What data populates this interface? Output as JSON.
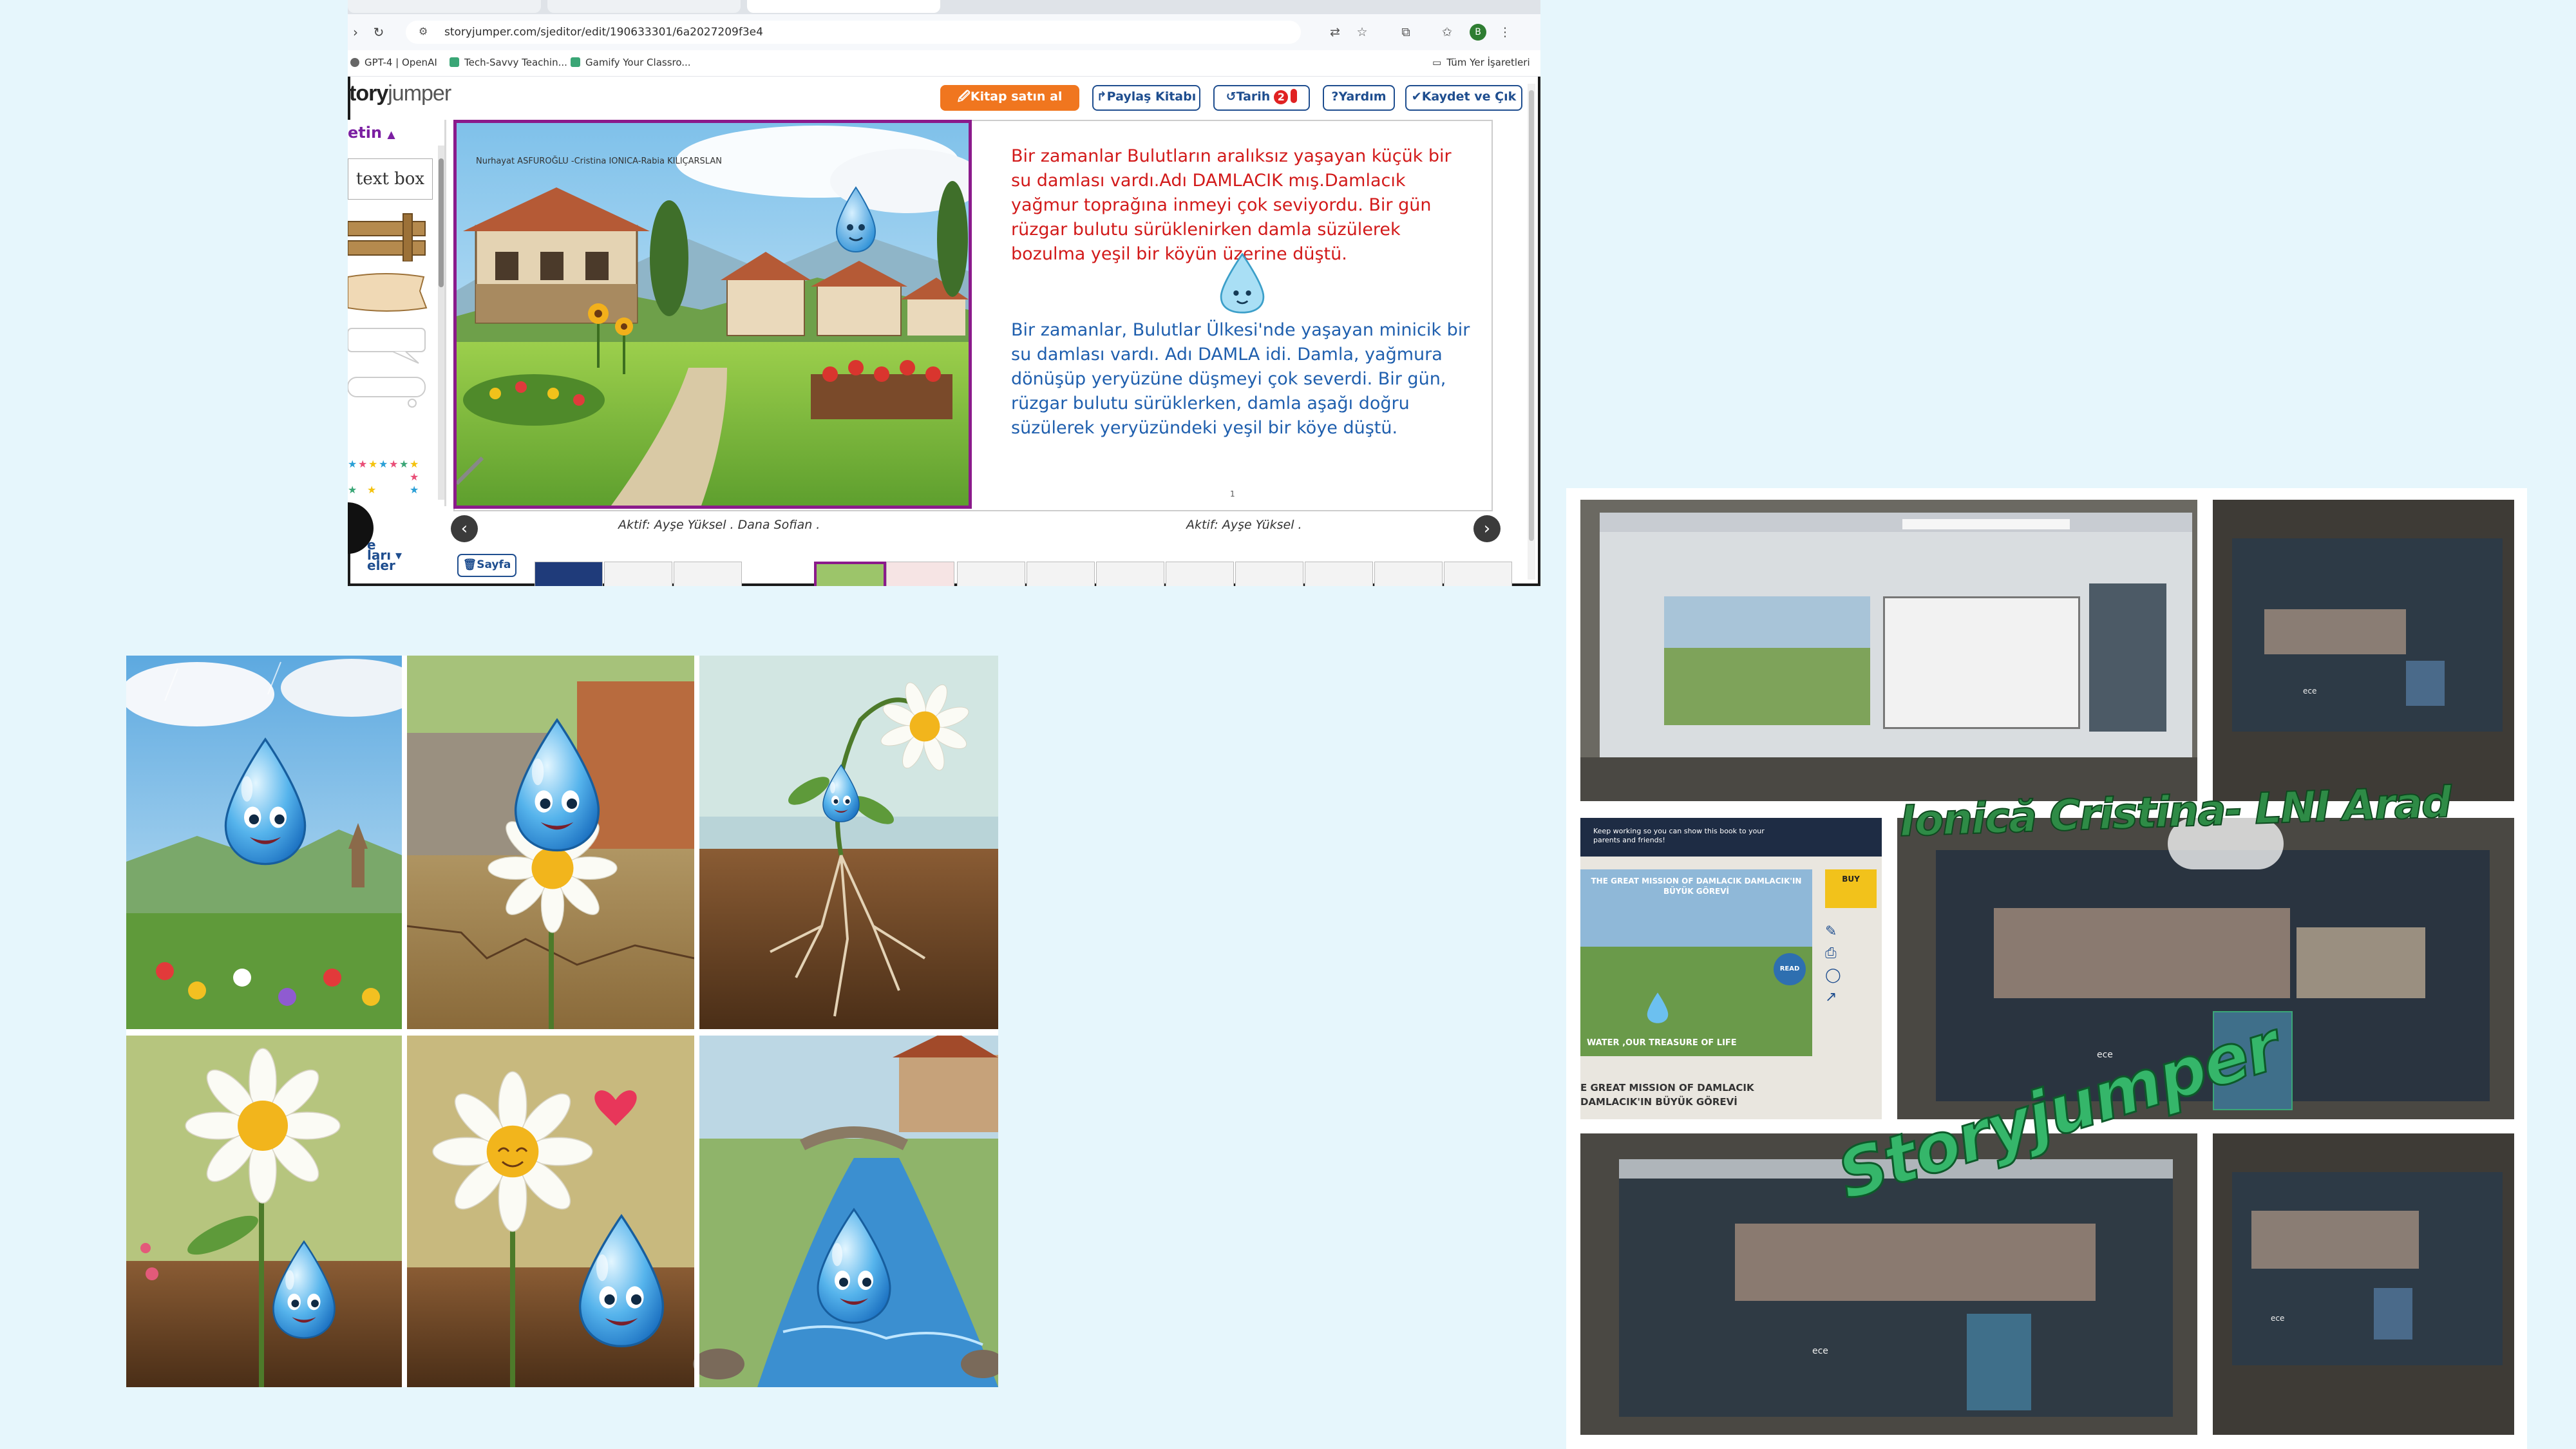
{
  "browser": {
    "url": "storyjumper.com/sjeditor/edit/190633301/6a2027209f3e4",
    "bookmarks": [
      "GPT-4 | OpenAI",
      "Tech-Savvy Teachin...",
      "Gamify Your Classro..."
    ],
    "bookmarks_folder": "Tüm Yer İşaretleri",
    "profile_letter": "B"
  },
  "editor": {
    "logo_start": "tory",
    "logo_end": "jumper",
    "toolbar": {
      "buy": "Kitap satın al",
      "share": "Paylaş Kitabı",
      "history": "Tarih",
      "history_badge": "2",
      "help": "Yardım",
      "save": "Kaydet ve Çık"
    },
    "left_panel": {
      "title": "etin",
      "textbox_label": "text box",
      "bottom_text_1": "e",
      "bottom_text_2": "ları",
      "bottom_text_3": "eler"
    },
    "page": {
      "credit": "Nurhayat ASFUROĞLU -Cristina IONICA-Rabia KILIÇARSLAN",
      "text_red": "Bir zamanlar Bulutların aralıksız yaşayan küçük bir su damlası vardı.Adı DAMLACIK mış.Damlacık yağmur toprağına inmeyi çok seviyordu. Bir gün rüzgar bulutu sürüklenirken damla süzülerek bozulma yeşil bir köyün üzerine düştü.",
      "text_blue": "Bir zamanlar, Bulutlar Ülkesi'nde yaşayan minicik bir su damlası vardı. Adı DAMLA idi. Damla, yağmura dönüşüp yeryüzüne düşmeyi çok severdi. Bir gün, rüzgar bulutu sürüklerken, damla aşağı doğru süzülerek yeryüzündeki yeşil bir köye düştü.",
      "page_number": "1",
      "author_left": "Aktif: Ayşe Yüksel . Dana Sofian .",
      "author_right": "Aktif: Ayşe Yüksel .",
      "add_page": "Sayfa"
    }
  },
  "board": {
    "overlay_ionica": "Ionică Cristina- LNI Arad",
    "overlay_storyjumper": "Storyjumper",
    "book_cover_banner": "Keep working so you can show this book to your parents and friends!",
    "book_cover_title": "THE GREAT MISSION OF DAMLACIK DAMLACIK'IN BÜYÜK GÖREVİ",
    "book_cover_footer": "WATER ,OUR TREASURE OF LIFE",
    "book_cover_caption_1": "E GREAT MISSION OF DAMLACIK",
    "book_cover_caption_2": "DAMLACIK'IN BÜYÜK GÖREVİ",
    "book_cover_read": "READ",
    "buy_label": "BUY",
    "screen_name": "ece"
  },
  "colors": {
    "background": "#e6f6fc",
    "toolbar_blue": "#1f4e8f",
    "buy_orange": "#f0761f",
    "page_border": "#8b1a8b",
    "text_red": "#d21a1a",
    "text_blue": "#1f5fae",
    "overlay_green": "#35b66a"
  }
}
